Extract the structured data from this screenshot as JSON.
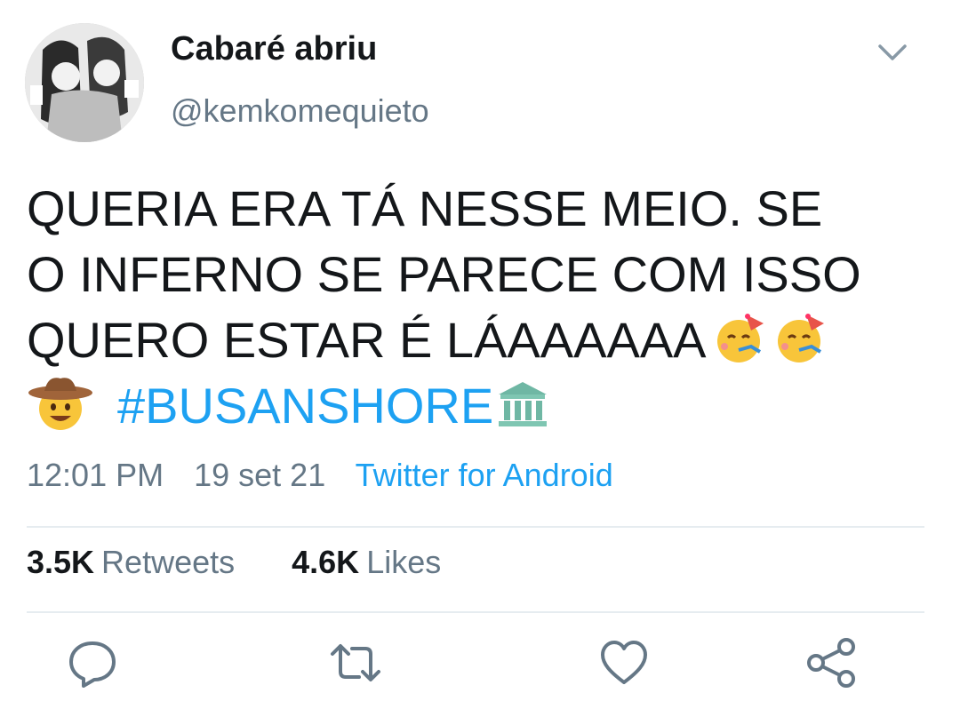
{
  "user": {
    "display_name": "Cabaré abriu",
    "handle": "@kemkomequieto"
  },
  "tweet": {
    "lines": [
      "QUERIA ERA TÁ NESSE MEIO. SE",
      "O INFERNO SE PARECE COM ISSO",
      "QUERO ESTAR É LÁAAAAAA"
    ],
    "hashtag": "#BUSANSHORE"
  },
  "meta": {
    "time": "12:01 PM",
    "date": "19 set 21",
    "source": "Twitter for Android"
  },
  "stats": {
    "retweets_count": "3.5K",
    "retweets_label": "Retweets",
    "likes_count": "4.6K",
    "likes_label": "Likes"
  },
  "icons": {
    "caret": "chevron-down-icon",
    "reply": "reply-icon",
    "retweet": "retweet-icon",
    "like": "heart-icon",
    "share": "share-icon",
    "emojis": [
      "partying-face-emoji",
      "partying-face-emoji",
      "cowboy-face-emoji",
      "classical-building-emoji"
    ]
  },
  "colors": {
    "link": "#1da1f2",
    "secondary_text": "#657786",
    "primary_text": "#14171a",
    "divider": "#e6ecf0"
  }
}
